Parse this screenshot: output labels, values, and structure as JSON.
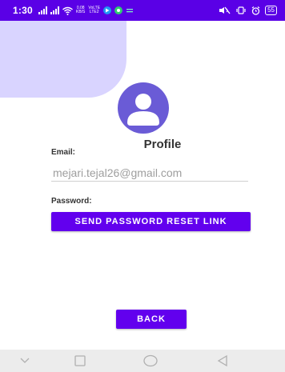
{
  "status_bar": {
    "time": "1:30",
    "network_text_top": "0.08",
    "network_text_bottom": "KB/S",
    "volte_top": "VoLTE",
    "volte_bottom": "LTE2",
    "battery": "55",
    "icons": [
      "signal-icon",
      "signal-icon",
      "wifi-icon",
      "network-speed-icon",
      "volte-icon",
      "app-notification-icon",
      "app-notification-icon",
      "cast-icon",
      "mute-icon",
      "vibrate-icon",
      "alarm-icon",
      "battery-icon"
    ],
    "accent_color": "#5a00e6"
  },
  "profile": {
    "title": "Profile",
    "avatar_icon": "user-avatar-icon",
    "avatar_color": "#6a5bd6"
  },
  "form": {
    "email_label": "Email:",
    "email_value": "mejari.tejal26@gmail.com",
    "password_label": "Password:",
    "reset_button_label": "SEND PASSWORD RESET LINK"
  },
  "actions": {
    "back_button_label": "BACK",
    "button_color": "#6200ee"
  },
  "navigation_bar": {
    "buttons": [
      "recents-icon",
      "home-icon",
      "back-icon",
      "collapse-icon"
    ]
  }
}
